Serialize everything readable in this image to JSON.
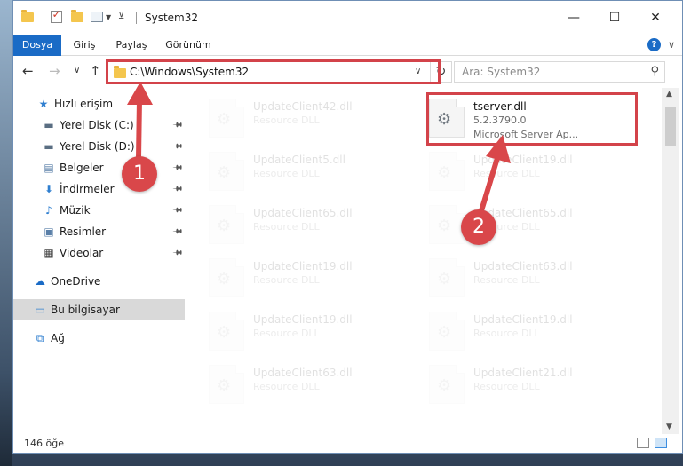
{
  "window": {
    "title": "System32",
    "minimize_glyph": "—",
    "maximize_glyph": "☐",
    "close_glyph": "✕"
  },
  "ribbon": {
    "tabs": [
      "Dosya",
      "Giriş",
      "Paylaş",
      "Görünüm"
    ],
    "collapse_glyph": "∨",
    "help_glyph": "?"
  },
  "nav": {
    "back_glyph": "←",
    "forward_glyph": "→",
    "recent_glyph": "∨",
    "up_glyph": "↑",
    "address_path": "C:\\Windows\\System32",
    "address_dropdown_glyph": "∨",
    "refresh_glyph": "↻",
    "search_placeholder": "Ara: System32",
    "search_icon_glyph": "⚲"
  },
  "sidebar": {
    "items": [
      {
        "label": "Hızlı erişim",
        "icon": "star-icon",
        "glyph": "★",
        "color": "#2f7fd0",
        "pinned": false
      },
      {
        "label": "Yerel Disk (C:)",
        "icon": "drive-icon",
        "glyph": "▬",
        "color": "#5a6e82",
        "pinned": true
      },
      {
        "label": "Yerel Disk (D:)",
        "icon": "drive-icon",
        "glyph": "▬",
        "color": "#5a6e82",
        "pinned": true
      },
      {
        "label": "Belgeler",
        "icon": "document-icon",
        "glyph": "▤",
        "color": "#5a7fa8",
        "pinned": true
      },
      {
        "label": "İndirmeler",
        "icon": "download-icon",
        "glyph": "⬇",
        "color": "#2f7fd0",
        "pinned": true
      },
      {
        "label": "Müzik",
        "icon": "music-icon",
        "glyph": "♪",
        "color": "#2f7fd0",
        "pinned": true
      },
      {
        "label": "Resimler",
        "icon": "pictures-icon",
        "glyph": "▣",
        "color": "#5a7fa8",
        "pinned": true
      },
      {
        "label": "Videolar",
        "icon": "video-icon",
        "glyph": "▦",
        "color": "#444444",
        "pinned": true
      },
      {
        "label": "OneDrive",
        "icon": "cloud-icon",
        "glyph": "☁",
        "color": "#1a6bc6",
        "pinned": false
      },
      {
        "label": "Bu bilgisayar",
        "icon": "computer-icon",
        "glyph": "▭",
        "color": "#2f7fd0",
        "pinned": false
      },
      {
        "label": "Ağ",
        "icon": "network-icon",
        "glyph": "⧉",
        "color": "#2f7fd0",
        "pinned": false
      }
    ],
    "pin_glyph": "📌"
  },
  "files": [
    {
      "name": "UpdateClient42.dll",
      "sub": "Resource DLL"
    },
    {
      "name": "tserver.dll",
      "sub": "5.2.3790.0",
      "sub2": "Microsoft Server Ap..."
    },
    {
      "name": "UpdateClient5.dll",
      "sub": "Resource DLL"
    },
    {
      "name": "UpdateClient19.dll",
      "sub": "Resource DLL"
    },
    {
      "name": "UpdateClient65.dll",
      "sub": "Resource DLL"
    },
    {
      "name": "UpdateClient65.dll",
      "sub": "Resource DLL"
    },
    {
      "name": "UpdateClient19.dll",
      "sub": "Resource DLL"
    },
    {
      "name": "UpdateClient63.dll",
      "sub": "Resource DLL"
    },
    {
      "name": "UpdateClient19.dll",
      "sub": "Resource DLL"
    },
    {
      "name": "UpdateClient19.dll",
      "sub": "Resource DLL"
    },
    {
      "name": "UpdateClient63.dll",
      "sub": "Resource DLL"
    },
    {
      "name": "UpdateClient21.dll",
      "sub": "Resource DLL"
    }
  ],
  "gear_glyph": "⚙",
  "status": {
    "count": "146 öğe"
  },
  "callouts": [
    "1",
    "2"
  ],
  "colors": {
    "accent": "#1a6bc6",
    "highlight": "#d3434a",
    "callout": "#d9474a"
  }
}
